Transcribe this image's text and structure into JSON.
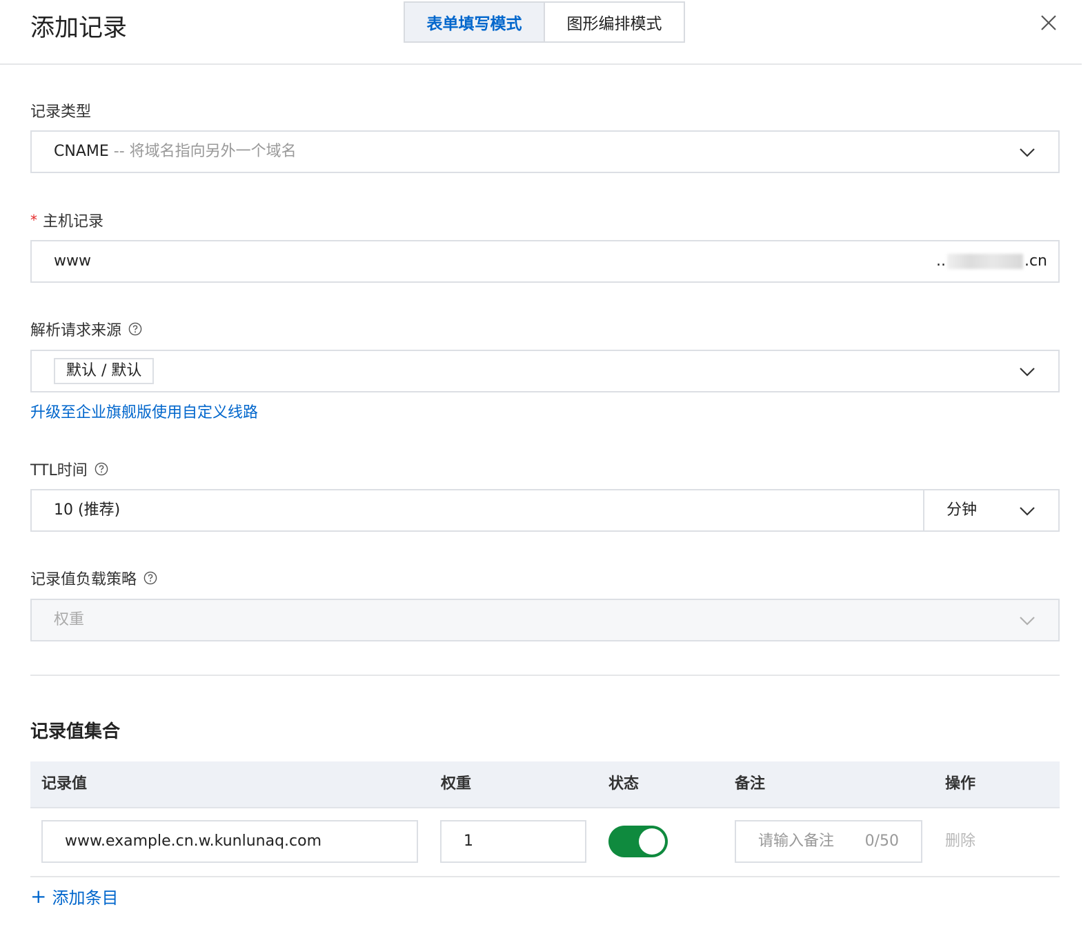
{
  "dialog": {
    "title": "添加记录",
    "tabs": [
      {
        "label": "表单填写模式",
        "active": true
      },
      {
        "label": "图形编排模式",
        "active": false
      }
    ]
  },
  "form": {
    "record_type": {
      "label": "记录类型",
      "value": "CNAME",
      "hint": "-- 将域名指向另外一个域名"
    },
    "host": {
      "label": "主机记录",
      "required_mark": "*",
      "value": "www",
      "suffix_prefix": "..",
      "suffix_end": ".cn"
    },
    "source": {
      "label": "解析请求来源",
      "tag": "默认 / 默认",
      "upgrade_link": "升级至企业旗舰版使用自定义线路"
    },
    "ttl": {
      "label": "TTL时间",
      "value": "10 (推荐)",
      "unit": "分钟"
    },
    "strategy": {
      "label": "记录值负载策略",
      "value": "权重"
    }
  },
  "records": {
    "title": "记录值集合",
    "headers": [
      "记录值",
      "权重",
      "状态",
      "备注",
      "操作"
    ],
    "rows": [
      {
        "value": "www.example.cn.w.kunlunaq.com",
        "weight": "1",
        "status_on": true,
        "remark_placeholder": "请输入备注",
        "remark_count": "0/50",
        "action": "删除"
      }
    ],
    "add_label": "添加条目"
  },
  "colors": {
    "accent": "#0066cc",
    "toggle_on": "#0f8a3e",
    "required": "#e52b2b"
  }
}
